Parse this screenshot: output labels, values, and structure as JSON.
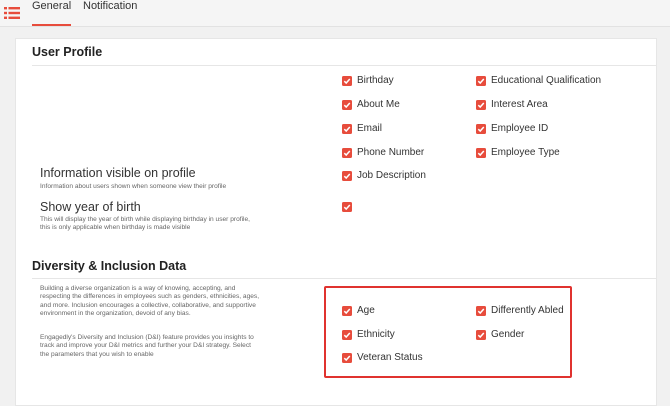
{
  "tabs": [
    {
      "label": "General",
      "active": true
    },
    {
      "label": "Notification",
      "active": false
    }
  ],
  "user_profile": {
    "title": "User Profile",
    "checkboxes_left": [
      "Birthday",
      "About Me",
      "Email",
      "Phone Number",
      "Job Description"
    ],
    "checkboxes_right": [
      "Educational Qualification",
      "Interest Area",
      "Employee ID",
      "Employee Type"
    ],
    "info_visible": {
      "label": "Information visible on profile",
      "desc": "Information about users shown when someone view their profile"
    },
    "show_year": {
      "label": "Show year of birth",
      "desc_line1": "This will display the year of birth while displaying birthday in user profile,",
      "desc_line2": "this is only applicable when birthday is made visible"
    }
  },
  "dni": {
    "title": "Diversity & Inclusion Data",
    "para1": [
      "Building a diverse organization is a way of knowing, accepting, and",
      "respecting the differences in employees such as genders, ethnicities, ages,",
      "and more. Inclusion encourages a collective, collaborative, and supportive",
      "environment in the organization, devoid of any bias."
    ],
    "para2": [
      "Engagedly's Diversity and Inclusion (D&I) feature provides you insights to",
      "track and improve your D&I metrics and further your D&I strategy. Select",
      "the parameters that you wish to enable"
    ],
    "checkboxes_left": [
      "Age",
      "Ethnicity",
      "Veteran Status"
    ],
    "checkboxes_right": [
      "Differently Abled",
      "Gender"
    ]
  },
  "colors": {
    "accent": "#e74c3c",
    "highlight_border": "#e0322f"
  }
}
